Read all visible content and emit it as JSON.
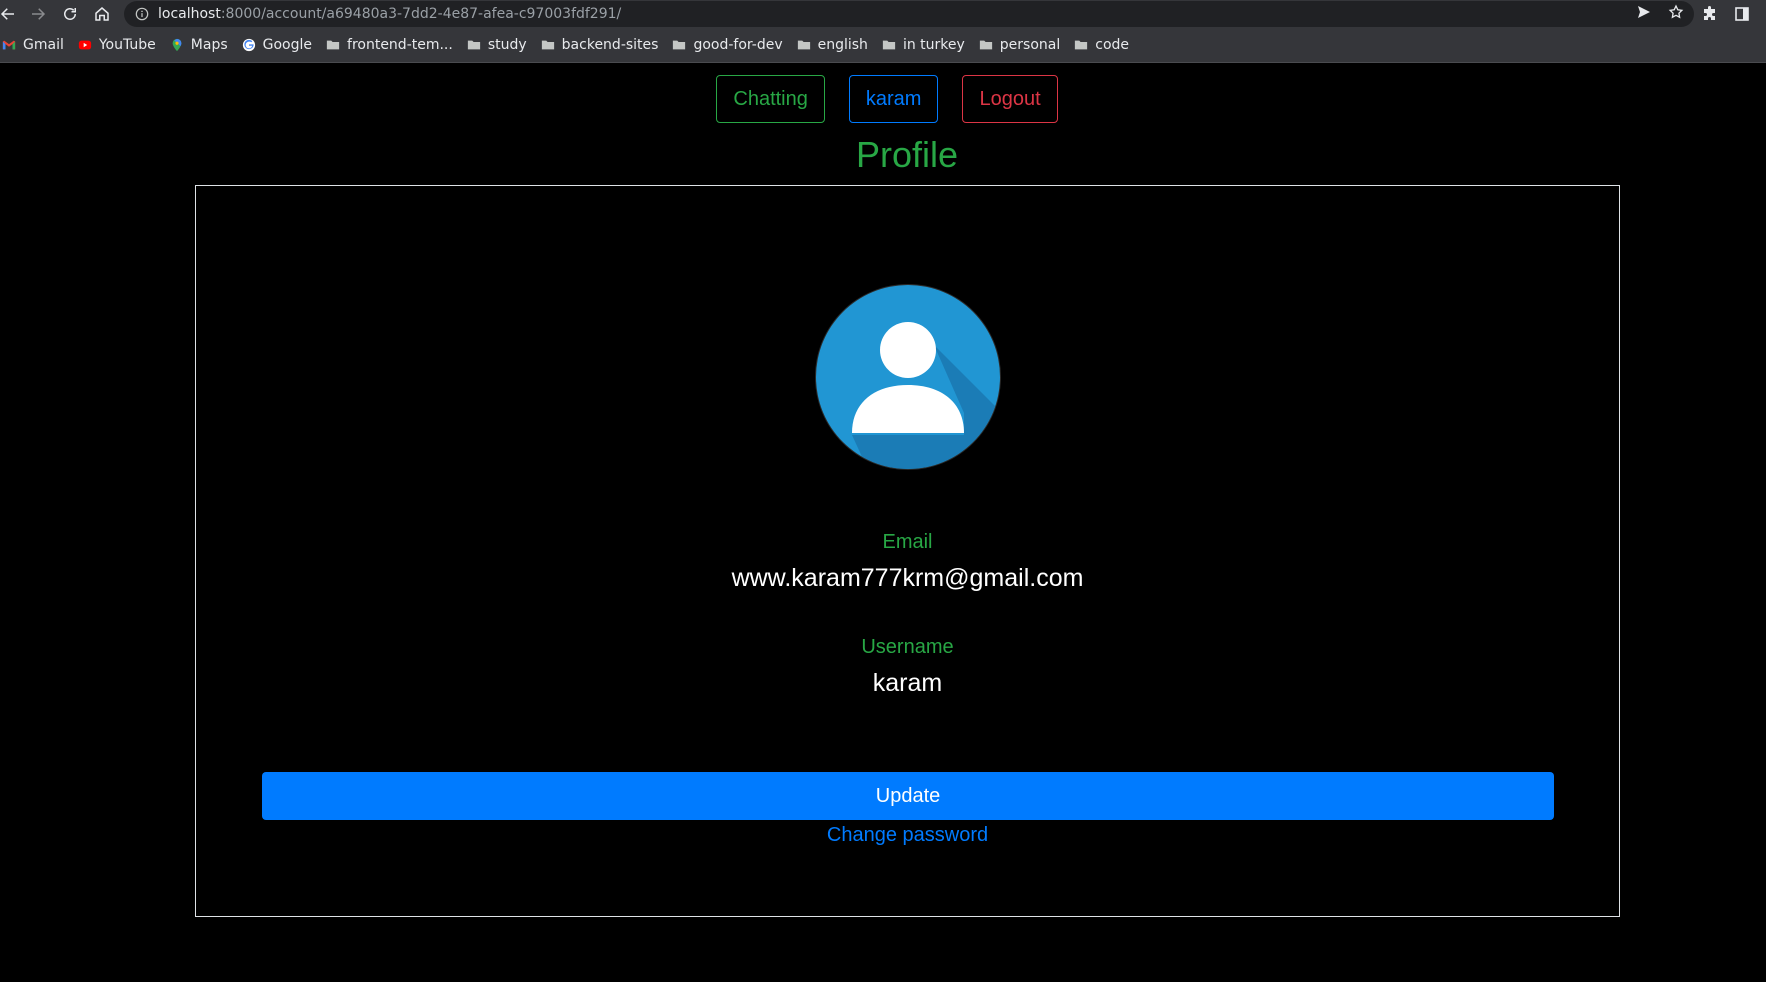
{
  "browser": {
    "url_host": "localhost",
    "url_rest": ":8000/account/a69480a3-7dd2-4e87-afea-c97003fdf291/",
    "bookmarks": [
      {
        "label": "Gmail",
        "icon": "gmail-icon"
      },
      {
        "label": "YouTube",
        "icon": "youtube-icon"
      },
      {
        "label": "Maps",
        "icon": "maps-icon"
      },
      {
        "label": "Google",
        "icon": "google-icon"
      },
      {
        "label": "frontend-tem...",
        "icon": "folder-icon"
      },
      {
        "label": "study",
        "icon": "folder-icon"
      },
      {
        "label": "backend-sites",
        "icon": "folder-icon"
      },
      {
        "label": "good-for-dev",
        "icon": "folder-icon"
      },
      {
        "label": "english",
        "icon": "folder-icon"
      },
      {
        "label": "in turkey",
        "icon": "folder-icon"
      },
      {
        "label": "personal",
        "icon": "folder-icon"
      },
      {
        "label": "code",
        "icon": "folder-icon"
      }
    ]
  },
  "nav": {
    "chatting": "Chatting",
    "user": "karam",
    "logout": "Logout"
  },
  "page": {
    "title": "Profile"
  },
  "profile": {
    "email_label": "Email",
    "email_value": "www.karam777krm@gmail.com",
    "username_label": "Username",
    "username_value": "karam",
    "update_label": "Update",
    "change_password_label": "Change password"
  },
  "colors": {
    "green": "#28a745",
    "blue": "#007bff",
    "red": "#dc3545",
    "avatar_bg": "#2196d3"
  }
}
